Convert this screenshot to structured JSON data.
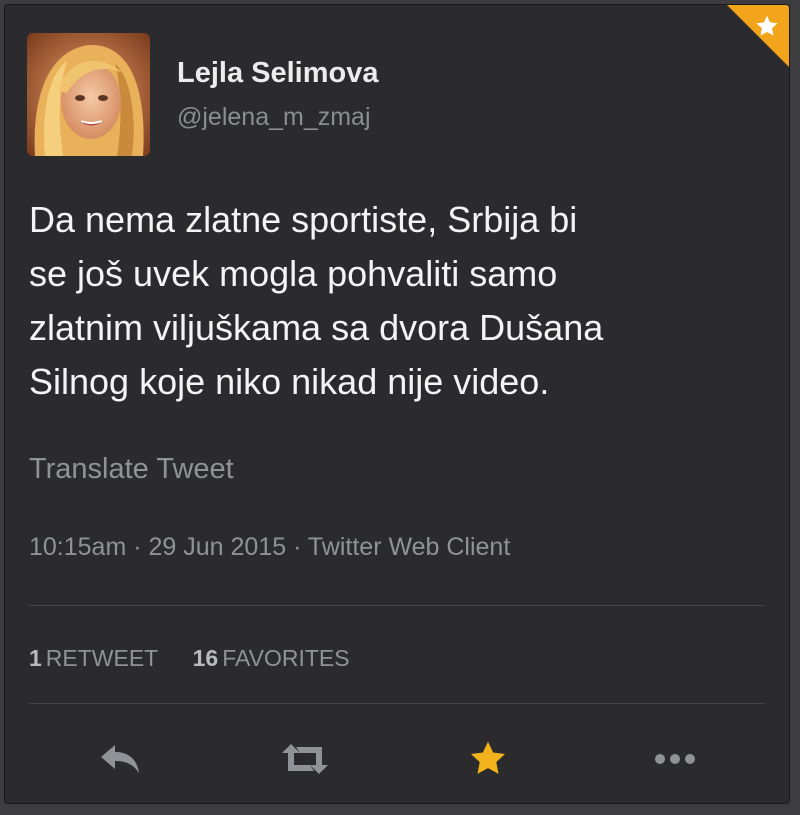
{
  "user": {
    "name": "Lejla Selimova",
    "handle": "@jelena_m_zmaj"
  },
  "tweet": {
    "text_lines": [
      "Da nema zlatne sportiste, Srbija bi",
      "se još uvek mogla pohvaliti samo",
      "zlatnim viljuškama sa dvora Dušana",
      "Silnog koje niko nikad nije video."
    ],
    "translate_label": "Translate Tweet",
    "timestamp": "10:15am · 29 Jun 2015 · Twitter Web Client"
  },
  "stats": {
    "retweets_count": "1",
    "retweets_label": "RETWEET",
    "favorites_count": "16",
    "favorites_label": "FAVORITES"
  },
  "actions": {
    "reply_icon": "reply-icon",
    "retweet_icon": "retweet-icon",
    "favorite_icon": "star-icon",
    "more_icon": "more-dots-icon"
  },
  "colors": {
    "favorite_active": "#f2a41b",
    "card_background": "#2b2b2e",
    "action_icon": "#8f9296"
  },
  "state": {
    "favorited": true
  }
}
